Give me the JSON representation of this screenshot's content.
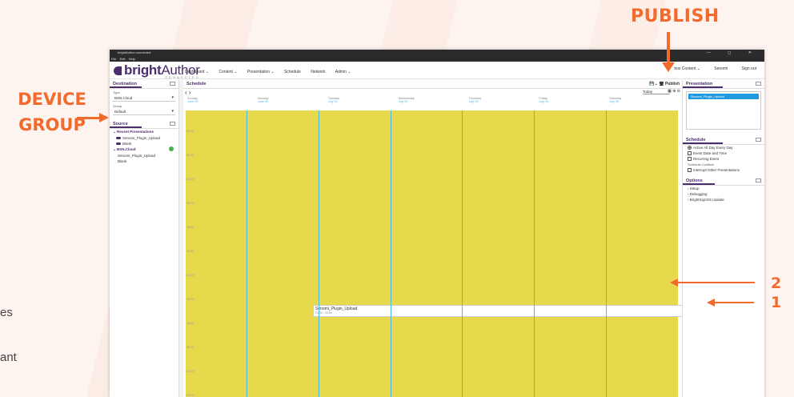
{
  "callouts": {
    "publish": "PUBLISH",
    "device_group_line1": "DEVICE",
    "device_group_line2": "GROUP",
    "number_2": "2",
    "number_1": "1"
  },
  "left_edge_text": [
    "es",
    "ant"
  ],
  "window": {
    "title": "brightAuthor:connected",
    "menu": [
      "File",
      "Edit",
      "Help"
    ],
    "controls": "— ◻ ✕"
  },
  "header": {
    "logo_bold": "bright",
    "logo_light": "Author",
    "logo_sub": "CONNECTED",
    "nav": [
      "Dashboard ⌄",
      "Content ⌄",
      "Presentation ⌄",
      "Schedule",
      "Network",
      "Admin ⌄"
    ],
    "account": "bos Content ⌄",
    "user": "Senomi",
    "sign_out": "Sign out"
  },
  "destination": {
    "title": "Destination",
    "type_label": "Type",
    "type_value": "BSN.Cloud",
    "group_label": "Group",
    "group_value": "Default"
  },
  "source": {
    "title": "Source",
    "recent_header": "Recent Presentations",
    "recent_items": [
      "Senomi_Plugin_Upload",
      "Blank"
    ],
    "cloud_header": "BSN.Cloud",
    "cloud_items": [
      "Senomi_Plugin_Upload",
      "Blank"
    ]
  },
  "schedule": {
    "title": "Schedule",
    "publish_btn": "Publish",
    "today": "Today",
    "days": [
      {
        "name": "Sunday",
        "date": "June 29"
      },
      {
        "name": "Monday",
        "date": "June 30"
      },
      {
        "name": "Tuesday",
        "date": "July 01"
      },
      {
        "name": "Wednesday",
        "date": "July 02"
      },
      {
        "name": "Thursday",
        "date": "July 03"
      },
      {
        "name": "Friday",
        "date": "July 04"
      },
      {
        "name": "Saturday",
        "date": "July 05"
      }
    ],
    "hours": [
      "02:00",
      "04:00",
      "06:00",
      "08:00",
      "10:00",
      "12:00",
      "14:00",
      "16:00",
      "18:00",
      "20:00",
      "22:00",
      "24:00"
    ],
    "event": {
      "name": "Senomi_Plugin_Upload",
      "time": "00:00 - 23:59"
    }
  },
  "presentation": {
    "title": "Presentation",
    "item": "Senomi_Plugin_Upload"
  },
  "schedule_panel": {
    "title": "Schedule",
    "opt_all_day": "Active All Day Every Day",
    "opt_event_date": "Event Date and Time",
    "opt_recurring": "Recurring Event",
    "conflicts_label": "Schedule Conflicts",
    "interrupt": "Interrupt Other Presentations"
  },
  "options": {
    "title": "Options",
    "items": [
      "Setup",
      "Debugging",
      "BrightSignOS Update"
    ]
  },
  "colors": {
    "accent": "#f26a2c",
    "brand": "#4b2d6e",
    "schedule_fill": "#e8d94c",
    "day_divider": "#4db8e0",
    "selection": "#1e9be0"
  }
}
